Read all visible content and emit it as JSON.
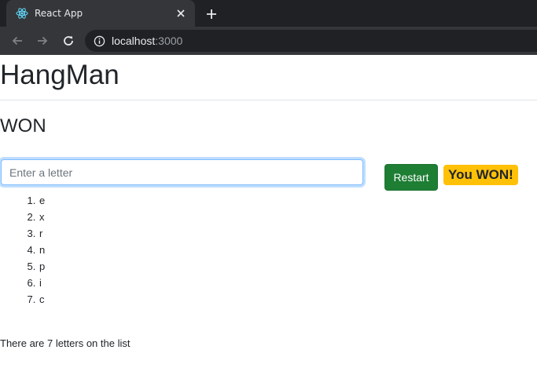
{
  "browser": {
    "tab_title": "React App",
    "favicon_icon": "react-logo-icon",
    "close_icon": "close-icon",
    "new_tab_icon": "plus-icon",
    "url_host": "localhost",
    "url_port": ":3000",
    "nav_icons": [
      "back-arrow-icon",
      "forward-arrow-icon",
      "reload-icon",
      "info-icon"
    ]
  },
  "app": {
    "title": "HangMan",
    "status": "WON",
    "input": {
      "placeholder": "Enter a letter",
      "value": ""
    },
    "restart_label": "Restart",
    "result_badge": "You WON!",
    "letters": [
      "e",
      "x",
      "r",
      "n",
      "p",
      "i",
      "c"
    ],
    "count_text": "There are 7 letters on the list"
  },
  "colors": {
    "restart_bg": "#1e7e34",
    "badge_bg": "#ffc107",
    "input_focus_border": "#80bdff",
    "chrome_dark": "#202124",
    "chrome_toolbar": "#35363a"
  }
}
